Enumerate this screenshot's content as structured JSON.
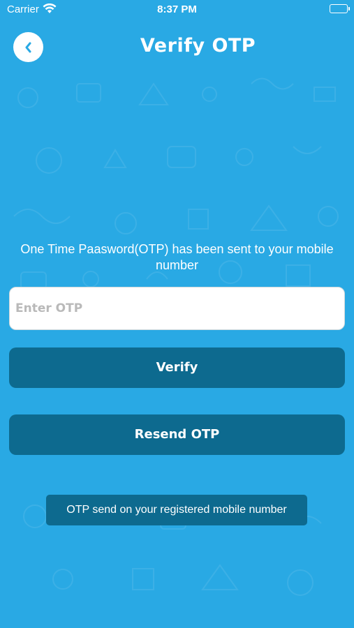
{
  "status_bar": {
    "carrier": "Carrier",
    "time": "8:37 PM",
    "wifi_icon": "wifi-icon",
    "battery_icon": "battery-icon"
  },
  "header": {
    "back_icon": "chevron-left-icon",
    "title": "Verify OTP"
  },
  "main": {
    "message": "One Time Paasword(OTP) has been sent to your mobile number",
    "otp_input": {
      "placeholder": "Enter OTP",
      "value": ""
    },
    "verify_label": "Verify",
    "resend_label": "Resend OTP"
  },
  "toast": {
    "text": "OTP send on your registered mobile number"
  },
  "colors": {
    "background": "#29a9e4",
    "button": "#0d6a8f",
    "text": "#ffffff"
  }
}
